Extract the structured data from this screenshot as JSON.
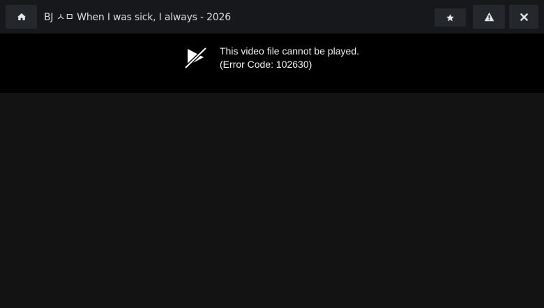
{
  "header": {
    "title": "BJ ㅅㅁ When I was sick, I always - 2026",
    "home_icon": "home-icon",
    "favorite_icon": "star-icon",
    "report_icon": "warning-icon",
    "close_icon": "close-icon"
  },
  "player": {
    "error_icon": "video-blocked-icon",
    "error_line1": "This video file cannot be played.",
    "error_line2": "(Error Code: 102630)"
  },
  "colors": {
    "topbar": "#16181b",
    "button": "#24272b",
    "player_bg": "#000000",
    "page_bg": "#131313"
  }
}
